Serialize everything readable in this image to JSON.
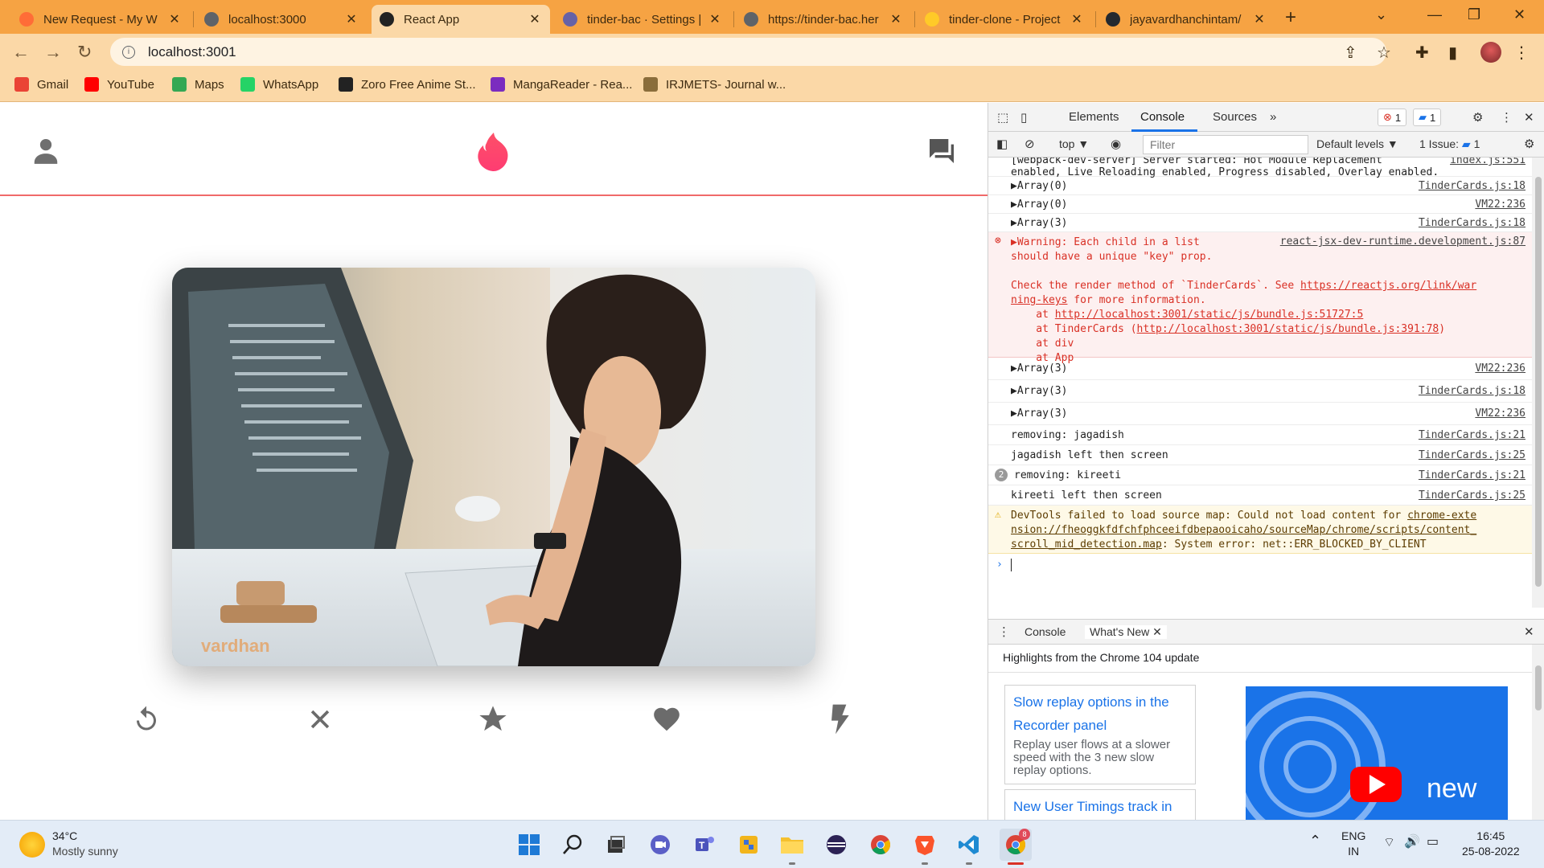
{
  "browser": {
    "tabs": [
      {
        "title": "New Request - My W",
        "favicon_color": "#ff6c37",
        "active": false
      },
      {
        "title": "localhost:3000",
        "favicon_color": "#5f6368",
        "active": false
      },
      {
        "title": "React App",
        "favicon_color": "#222",
        "active": true
      },
      {
        "title": "tinder-bac · Settings |",
        "favicon_color": "#6762a6",
        "active": false
      },
      {
        "title": "https://tinder-bac.her",
        "favicon_color": "#5f6368",
        "active": false
      },
      {
        "title": "tinder-clone - Project",
        "favicon_color": "#ffca28",
        "active": false
      },
      {
        "title": "jayavardhanchintam/",
        "favicon_color": "#24292f",
        "active": false
      }
    ],
    "new_tab_glyph": "+",
    "url": "localhost:3001",
    "bookmarks": [
      {
        "label": "Gmail",
        "color": "#ea4335"
      },
      {
        "label": "YouTube",
        "color": "#ff0000"
      },
      {
        "label": "Maps",
        "color": "#34a853"
      },
      {
        "label": "WhatsApp",
        "color": "#25d366"
      },
      {
        "label": "Zoro Free Anime St...",
        "color": "#222"
      },
      {
        "label": "MangaReader - Rea...",
        "color": "#7b2cbf"
      },
      {
        "label": "IRJMETS- Journal w...",
        "color": "#8a6d3b"
      }
    ]
  },
  "app": {
    "card_name": "vardhan",
    "accent": "#fe3c72",
    "icons": [
      "person-icon",
      "tinder-flame-icon",
      "forum-icon",
      "replay-icon",
      "close-icon",
      "star-icon",
      "heart-icon",
      "flash-icon"
    ]
  },
  "devtools": {
    "tabs": [
      "Elements",
      "Console",
      "Sources",
      "»"
    ],
    "active_tab": "Console",
    "error_count": "1",
    "message_count": "1",
    "context": "top ▼",
    "filter_placeholder": "Filter",
    "levels": "Default levels ▼",
    "issues": "1 Issue:",
    "issues_count": "1",
    "console": [
      {
        "type": "log",
        "text": "[webpack-dev-server] Server started: Hot Module Replacement\nenabled, Live Reloading enabled, Progress disabled, Overlay enabled.",
        "src": "index.js:551"
      },
      {
        "type": "log",
        "text": "▶Array(0)",
        "src": "TinderCards.js:18"
      },
      {
        "type": "log",
        "text": "▶Array(0)",
        "src": "VM22:236"
      },
      {
        "type": "log",
        "text": "▶Array(3)",
        "src": "TinderCards.js:18"
      },
      {
        "type": "error",
        "text": "▶Warning: Each child in a list\nshould have a unique \"key\" prop.",
        "src": "react-jsx-dev-runtime.development.js:87",
        "detail1": "Check the render method of `TinderCards`. See ",
        "link1": "https://reactjs.org/link/war",
        "link1b": "ning-keys",
        "detail2": " for more information.",
        "at1": "    at ",
        "at1link": "http://localhost:3001/static/js/bundle.js:51727:5",
        "at2": "    at TinderCards (",
        "at2link": "http://localhost:3001/static/js/bundle.js:391:78",
        "at2end": ")",
        "at3": "    at div",
        "at4": "    at App"
      },
      {
        "type": "log",
        "text": "▶Array(3)",
        "src": "VM22:236"
      },
      {
        "type": "log",
        "text": "▶Array(3)",
        "src": "TinderCards.js:18"
      },
      {
        "type": "log",
        "text": "▶Array(3)",
        "src": "VM22:236"
      },
      {
        "type": "log",
        "text": "removing: jagadish",
        "src": "TinderCards.js:21"
      },
      {
        "type": "log",
        "text": "jagadish left then screen",
        "src": "TinderCards.js:25"
      },
      {
        "type": "log",
        "text": "removing: kireeti",
        "src": "TinderCards.js:21",
        "repeat": "2"
      },
      {
        "type": "log",
        "text": "kireeti left then screen",
        "src": "TinderCards.js:25"
      },
      {
        "type": "warn",
        "text": "DevTools failed to load source map: Could not load content for ",
        "link": "chrome-exte\nnsion://fheoggkfdfchfphceeifdbepaooicaho/sourceMap/chrome/scripts/content_\nscroll_mid_detection.map",
        "text2": ": System error: net::ERR_BLOCKED_BY_CLIENT"
      }
    ],
    "prompt": "›",
    "drawer_tabs": [
      "Console",
      "What's New"
    ],
    "drawer_subtitle": "Highlights from the Chrome 104 update",
    "whats_new": [
      {
        "title": "Slow replay options in the Recorder panel",
        "desc": "Replay user flows at a slower speed with the 3 new slow replay options."
      },
      {
        "title": "New User Timings track in",
        "desc": ""
      }
    ],
    "video_caption": "new"
  },
  "taskbar": {
    "weather_temp": "34°C",
    "weather_desc": "Mostly sunny",
    "lang1": "ENG",
    "lang2": "IN",
    "time": "16:45",
    "date": "25-08-2022",
    "notification_count": "8"
  }
}
